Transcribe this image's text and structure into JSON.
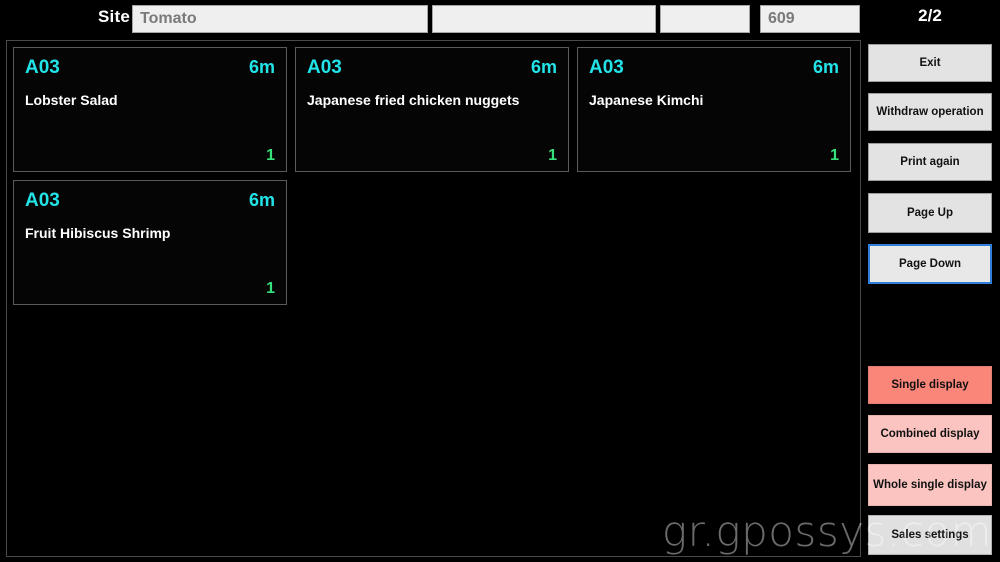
{
  "header": {
    "site_label": "Site",
    "site_value": "Tomato",
    "field_second_value": "",
    "field_second_placeholder": "",
    "field_third_value": "",
    "field_third_placeholder": "",
    "field_fourth_value": "609",
    "page_indicator": "2/2"
  },
  "orders": [
    {
      "table_id": "A03",
      "timer": "6m",
      "item_name": "Lobster Salad",
      "quantity": "1"
    },
    {
      "table_id": "A03",
      "timer": "6m",
      "item_name": "Japanese fried chicken nuggets",
      "quantity": "1"
    },
    {
      "table_id": "A03",
      "timer": "6m",
      "item_name": "Japanese Kimchi",
      "quantity": "1"
    },
    {
      "table_id": "A03",
      "timer": "6m",
      "item_name": "Fruit Hibiscus Shrimp",
      "quantity": "1"
    }
  ],
  "sidebar": {
    "exit": "Exit",
    "withdraw_operation": "Withdraw operation",
    "print_again": "Print again",
    "page_up": "Page Up",
    "page_down": "Page Down",
    "single_display": "Single display",
    "combined_display": "Combined display",
    "whole_single_display": "Whole single display",
    "sales_settings": "Sales settings"
  },
  "watermark": {
    "text": "gr.gpossys.com"
  },
  "colors": {
    "background": "#000000",
    "table_id": "#22e3e8",
    "timer": "#22e3e8",
    "item_name": "#ffffff",
    "quantity": "#36e07a",
    "panel_border": "#4a4a4a",
    "card_border": "#5a5a5a",
    "button_default": "#e3e3e3",
    "button_focus_border": "#2f7ed8",
    "accent_strong": "#fa8579",
    "accent_light": "#fbc4c0",
    "input_background": "#efeff0",
    "input_text": "#7a7a7a"
  }
}
